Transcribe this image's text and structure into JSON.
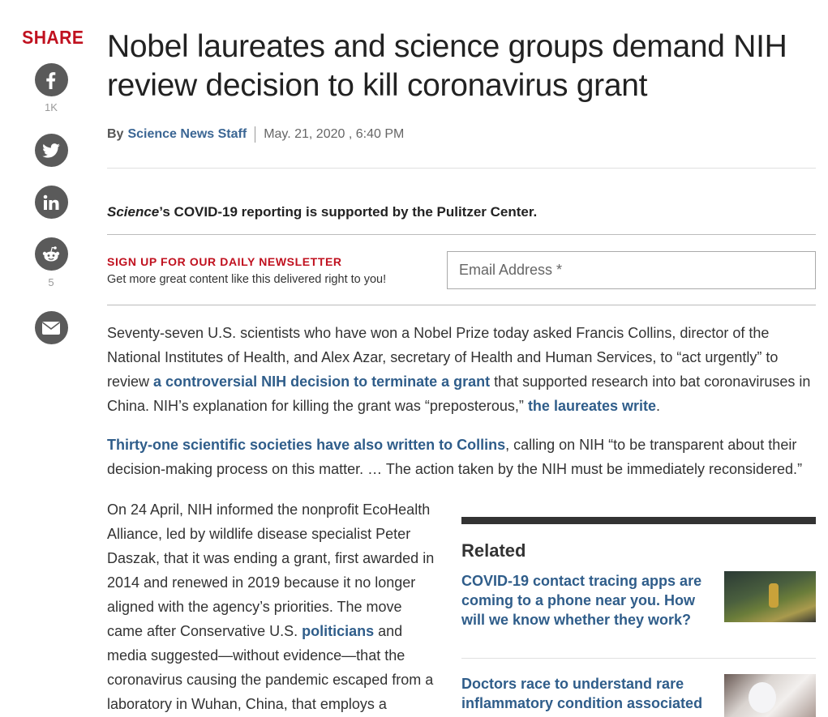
{
  "share": {
    "title": "SHARE",
    "facebook_count": "1K",
    "reddit_count": "5",
    "icons": [
      "facebook-icon",
      "twitter-icon",
      "linkedin-icon",
      "reddit-icon",
      "email-icon"
    ]
  },
  "article": {
    "headline": "Nobel laureates and science groups demand NIH review decision to kill coronavirus grant",
    "byline_prefix": "By",
    "author": "Science News Staff",
    "date": "May. 21, 2020 , 6:40 PM"
  },
  "support": {
    "science": "Science",
    "rest": "’s COVID-19 reporting is supported by the Pulitzer Center."
  },
  "newsletter": {
    "heading": "SIGN UP FOR OUR DAILY NEWSLETTER",
    "subtext": "Get more great content like this delivered right to you!",
    "email_placeholder": "Email Address *"
  },
  "body": {
    "p1_a": "Seventy-seven U.S. scientists who have won a Nobel Prize today asked Francis Collins, director of the National Institutes of Health, and Alex Azar, secretary of Health and Human Services, to “act urgently” to review ",
    "p1_link1": "a controversial NIH decision to terminate a grant",
    "p1_b": " that supported research into bat coronaviruses in China. NIH’s explanation for killing the grant was “preposterous,” ",
    "p1_link2": "the laureates write",
    "p1_c": ".",
    "p2_link": "Thirty-one scientific societies have also written to Collins",
    "p2_a": ", calling on NIH “to be transparent about their decision-making process on this matter. … The action taken by the NIH must be immediately reconsidered.”",
    "p3_a": "On 24 April, NIH informed the nonprofit EcoHealth Alliance, led by wildlife disease specialist Peter Daszak, that it was ending a grant, first awarded in 2014 and renewed in 2019 because it no longer aligned with the agency’s priorities. The move came after Conservative U.S. ",
    "p3_link": "politicians",
    "p3_b": " and media suggested—without evidence—that the coronavirus causing the pandemic escaped from a laboratory in Wuhan, China, that employs a"
  },
  "related": {
    "title": "Related",
    "items": [
      {
        "title": "COVID-19 contact tracing apps are coming to a phone near you. How will we know whether they work?"
      },
      {
        "title": "Doctors race to understand rare inflammatory condition associated"
      }
    ]
  },
  "colors": {
    "accent_red": "#c0111f",
    "link_blue": "#2f5d8a",
    "icon_gray": "#5a5a5a"
  }
}
